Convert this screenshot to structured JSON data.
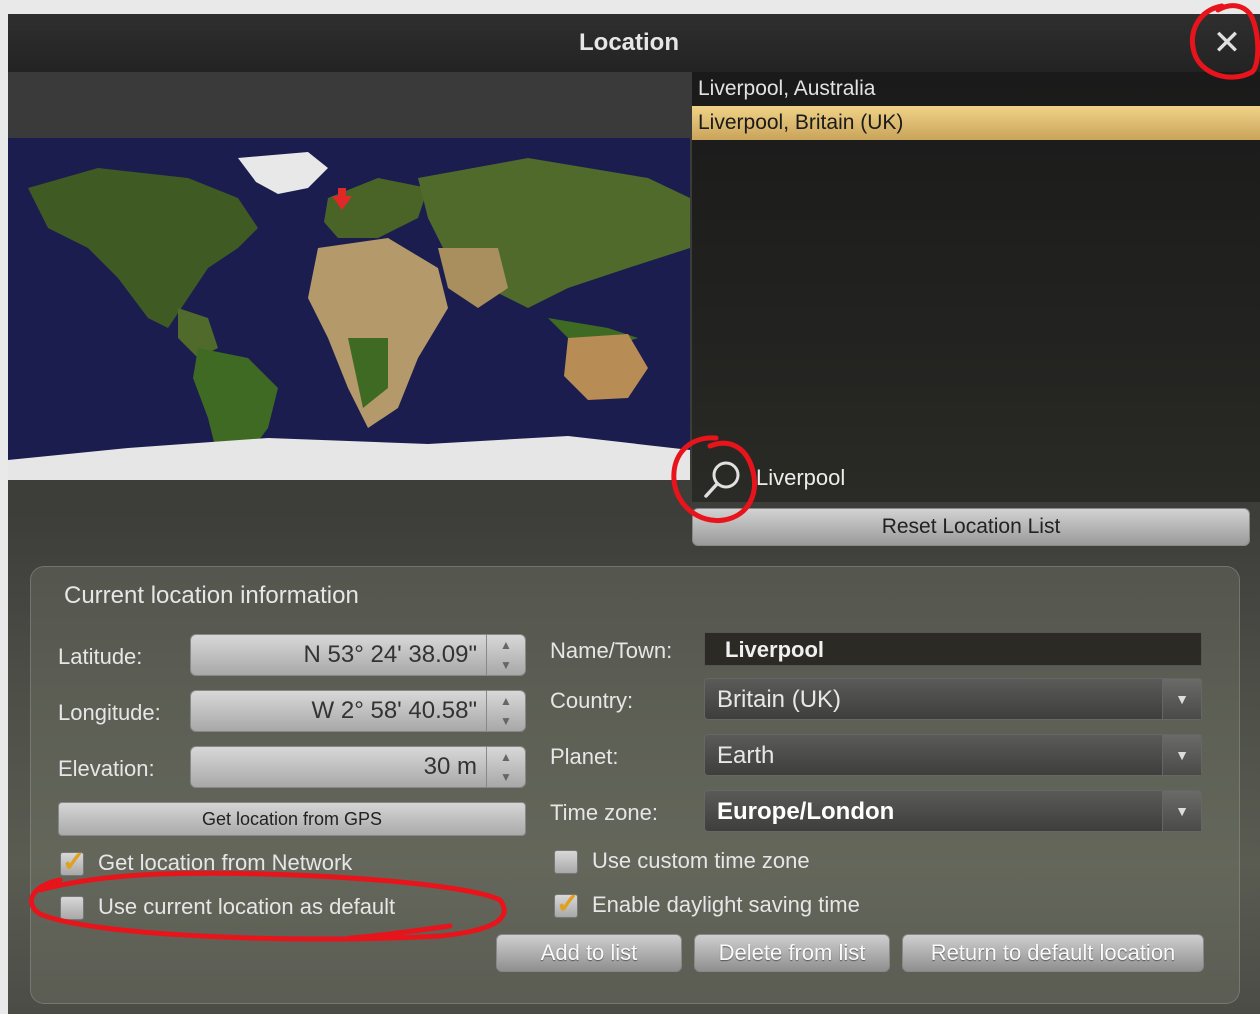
{
  "window": {
    "title": "Location"
  },
  "locations": [
    {
      "label": "Liverpool, Australia",
      "selected": false
    },
    {
      "label": "Liverpool, Britain (UK)",
      "selected": true
    }
  ],
  "search": {
    "value": "Liverpool"
  },
  "reset_button": "Reset Location List",
  "info": {
    "section_title": "Current location information",
    "latitude_label": "Latitude:",
    "latitude_value": "N 53° 24' 38.09\"",
    "longitude_label": "Longitude:",
    "longitude_value": "W 2° 58' 40.58\"",
    "elevation_label": "Elevation:",
    "elevation_value": "30 m",
    "gps_button": "Get location from GPS",
    "network_label": "Get location from Network",
    "network_checked": true,
    "default_label": "Use current location as default",
    "default_checked": false,
    "name_label": "Name/Town:",
    "name_value": "Liverpool",
    "country_label": "Country:",
    "country_value": "Britain (UK)",
    "planet_label": "Planet:",
    "planet_value": "Earth",
    "timezone_label": "Time zone:",
    "timezone_value": "Europe/London",
    "custom_tz_label": "Use custom time zone",
    "custom_tz_checked": false,
    "dst_label": "Enable daylight saving time",
    "dst_checked": true
  },
  "buttons": {
    "add": "Add to list",
    "delete": "Delete from list",
    "return_default": "Return to default location"
  },
  "colors": {
    "selected_row": "#e6c676",
    "annotation": "#e8141c",
    "check_mark": "#e0a020",
    "map_ocean": "#1b1d4f"
  },
  "icons": {
    "close": "close-icon",
    "search": "search-icon",
    "location_marker": "map-marker-icon"
  }
}
